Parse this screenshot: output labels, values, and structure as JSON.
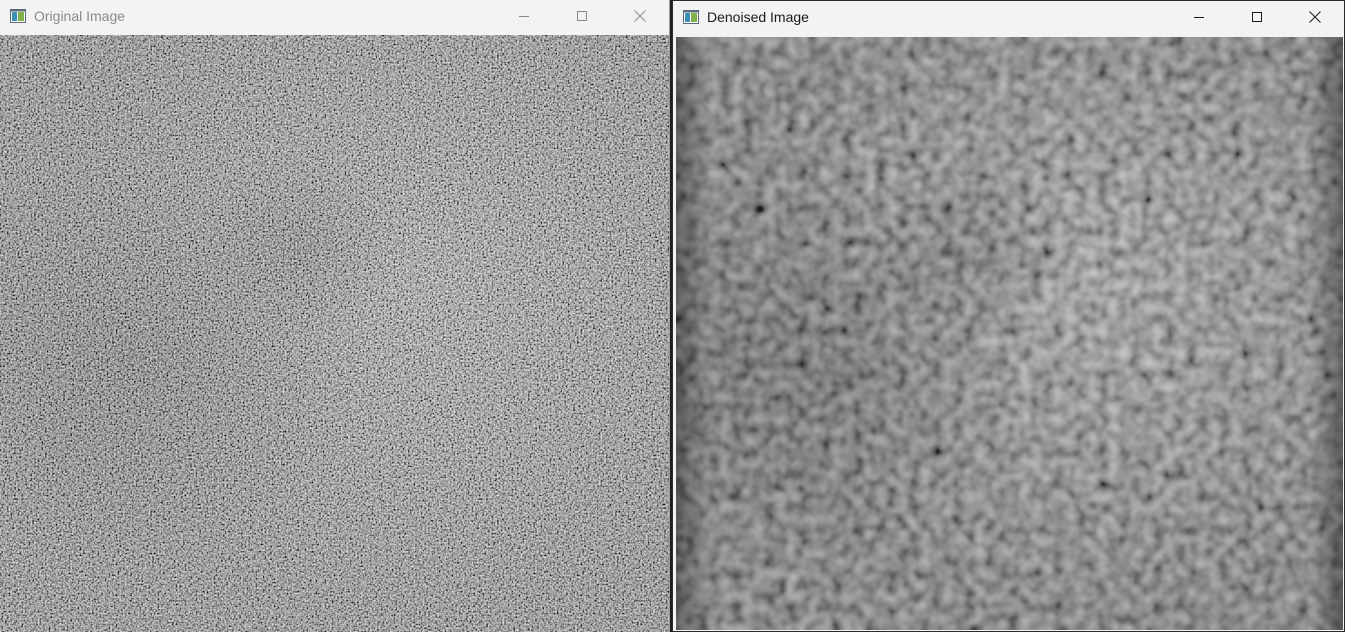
{
  "windows": {
    "original": {
      "title": "Original Image",
      "state": "inactive",
      "image_alt": "noisy grayscale image",
      "icons": {
        "app": "app-window-icon",
        "minimize": "minimize-icon",
        "maximize": "maximize-icon",
        "close": "close-icon"
      }
    },
    "denoised": {
      "title": "Denoised Image",
      "state": "active",
      "image_alt": "smoothed grayscale image",
      "icons": {
        "app": "app-window-icon",
        "minimize": "minimize-icon",
        "maximize": "maximize-icon",
        "close": "close-icon"
      }
    }
  },
  "colors": {
    "titlebar_bg": "#f3f3f3",
    "title_active": "#1a1a1a",
    "title_inactive": "#8a8a8a"
  }
}
